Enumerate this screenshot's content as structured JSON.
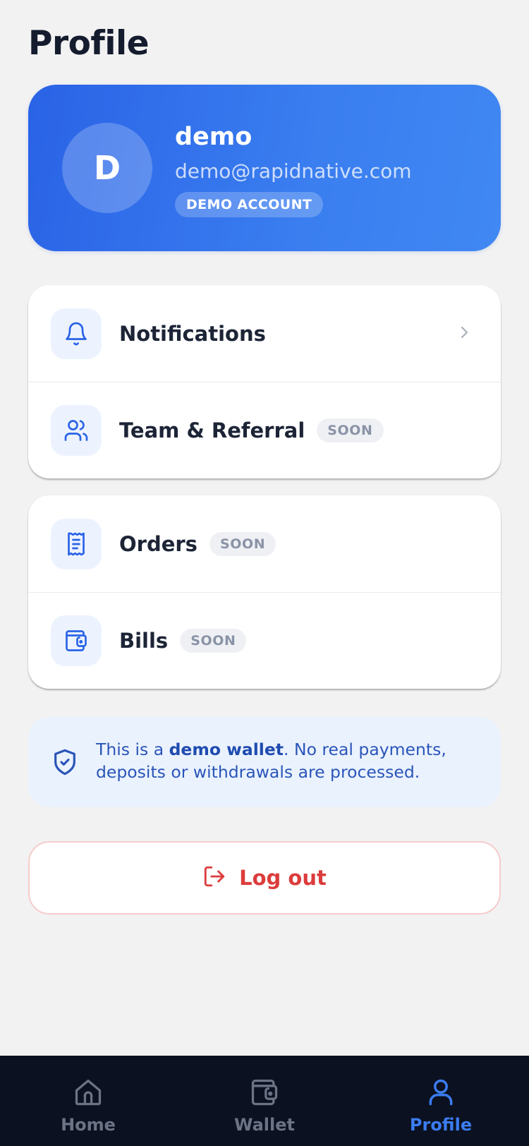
{
  "header": {
    "title": "Profile"
  },
  "profile": {
    "avatar_initial": "D",
    "name": "demo",
    "email": "demo@rapidnative.com",
    "badge": "DEMO ACCOUNT"
  },
  "menu_group_1": [
    {
      "label": "Notifications",
      "icon": "bell-icon",
      "badge": ""
    },
    {
      "label": "Team & Referral",
      "icon": "users-icon",
      "badge": "SOON"
    }
  ],
  "menu_group_2": [
    {
      "label": "Orders",
      "icon": "receipt-icon",
      "badge": "SOON"
    },
    {
      "label": "Bills",
      "icon": "wallet-icon",
      "badge": "SOON"
    }
  ],
  "notice": {
    "prefix": "This is a ",
    "emphasis": "demo wallet",
    "suffix": ". No real payments, deposits or withdrawals are processed.",
    "icon": "shield-check-icon"
  },
  "logout": {
    "label": "Log out",
    "icon": "logout-icon"
  },
  "tabs": [
    {
      "label": "Home",
      "icon": "home-icon",
      "active": false
    },
    {
      "label": "Wallet",
      "icon": "wallet-icon",
      "active": false
    },
    {
      "label": "Profile",
      "icon": "user-icon",
      "active": true
    }
  ],
  "colors": {
    "accent": "#3b7cf0",
    "card_gradient_start": "#2a63e6",
    "danger": "#dc3c3c",
    "tab_bar": "#0b1120"
  }
}
